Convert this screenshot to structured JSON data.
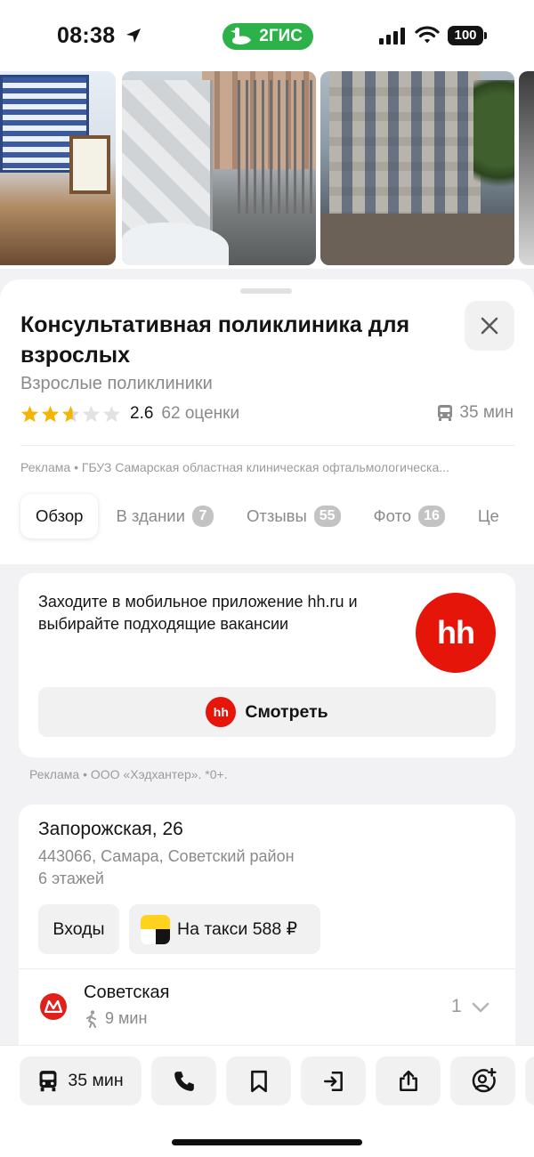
{
  "status_bar": {
    "time": "08:38",
    "app_badge": "2ГИС",
    "battery": "100"
  },
  "place": {
    "title": "Консультативная поликлиника для взрослых",
    "category": "Взрослые поликлиники",
    "rating": "2.6",
    "rating_value": 2.6,
    "rating_max": 5,
    "reviews_count": "62 оценки",
    "transit_time": "35 мин"
  },
  "ad_line": {
    "label": "Реклама",
    "text": "ГБУЗ Самарская областная клиническая офтальмологическа..."
  },
  "tabs": [
    {
      "label": "Обзор",
      "count": ""
    },
    {
      "label": "В здании",
      "count": "7"
    },
    {
      "label": "Отзывы",
      "count": "55"
    },
    {
      "label": "Фото",
      "count": "16"
    },
    {
      "label": "Це",
      "count": ""
    }
  ],
  "promo": {
    "text": "Заходите в мобильное приложение hh.ru и выбирайте подходящие вакансии",
    "logo_text": "hh",
    "button_icon_text": "hh",
    "button_label": "Смотреть",
    "ad_label": "Реклама",
    "ad_advertiser": "ООО «Хэдхантер». *0+."
  },
  "address": {
    "street": "Запорожская, 26",
    "city": "443066, Самара, Советский район",
    "floors": "6 этажей",
    "entrances_label": "Входы",
    "taxi_label": "На такси 588 ₽",
    "metro_station": "Советская",
    "metro_walk": "9 мин",
    "metro_count": "1"
  },
  "bottom_bar": {
    "route_label": "35 мин"
  },
  "colors": {
    "brand_green": "#2db24a",
    "hh_red": "#e5150a",
    "metro_red": "#e0201a",
    "star_gold": "#f4b400",
    "star_gray": "#d8d8d8",
    "muted_text": "#8a8a8a"
  },
  "icons": [
    "location-arrow-icon",
    "goose-icon",
    "signal-icon",
    "wifi-icon",
    "battery-icon",
    "close-icon",
    "star-icon",
    "bus-icon",
    "yandex-taxi-icon",
    "metro-icon",
    "walk-icon",
    "chevron-down-icon",
    "phone-icon",
    "bookmark-icon",
    "entrance-icon",
    "share-icon",
    "add-user-icon"
  ]
}
